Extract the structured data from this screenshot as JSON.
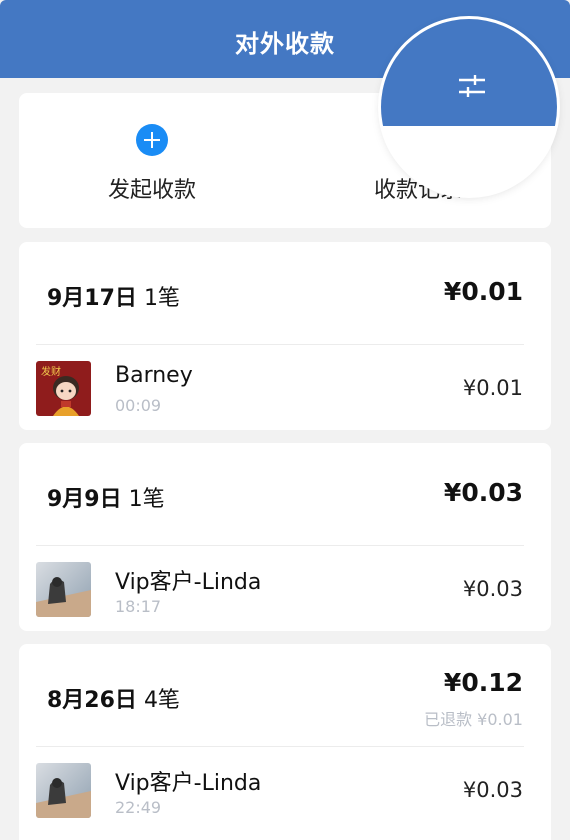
{
  "header": {
    "title": "对外收款"
  },
  "actions": {
    "start_label": "发起收款",
    "records_label": "收款记录"
  },
  "filter": {
    "icon": "sliders-icon"
  },
  "colors": {
    "primary": "#4478c3",
    "accent": "#1a8cf5",
    "muted": "#b9bec7"
  },
  "days": [
    {
      "date": "9月17日",
      "count": "1笔",
      "total": "¥0.01",
      "refund": "",
      "transactions": [
        {
          "name": "Barney",
          "time": "00:09",
          "amount": "¥0.01",
          "avatar": "cartoon-avatar"
        }
      ]
    },
    {
      "date": "9月9日",
      "count": "1笔",
      "total": "¥0.03",
      "refund": "",
      "transactions": [
        {
          "name": "Vip客户-Linda",
          "time": "18:17",
          "amount": "¥0.03",
          "avatar": "photo-avatar"
        }
      ]
    },
    {
      "date": "8月26日",
      "count": "4笔",
      "total": "¥0.12",
      "refund": "已退款 ¥0.01",
      "transactions": [
        {
          "name": "Vip客户-Linda",
          "time": "22:49",
          "amount": "¥0.03",
          "avatar": "photo-avatar"
        }
      ]
    }
  ]
}
